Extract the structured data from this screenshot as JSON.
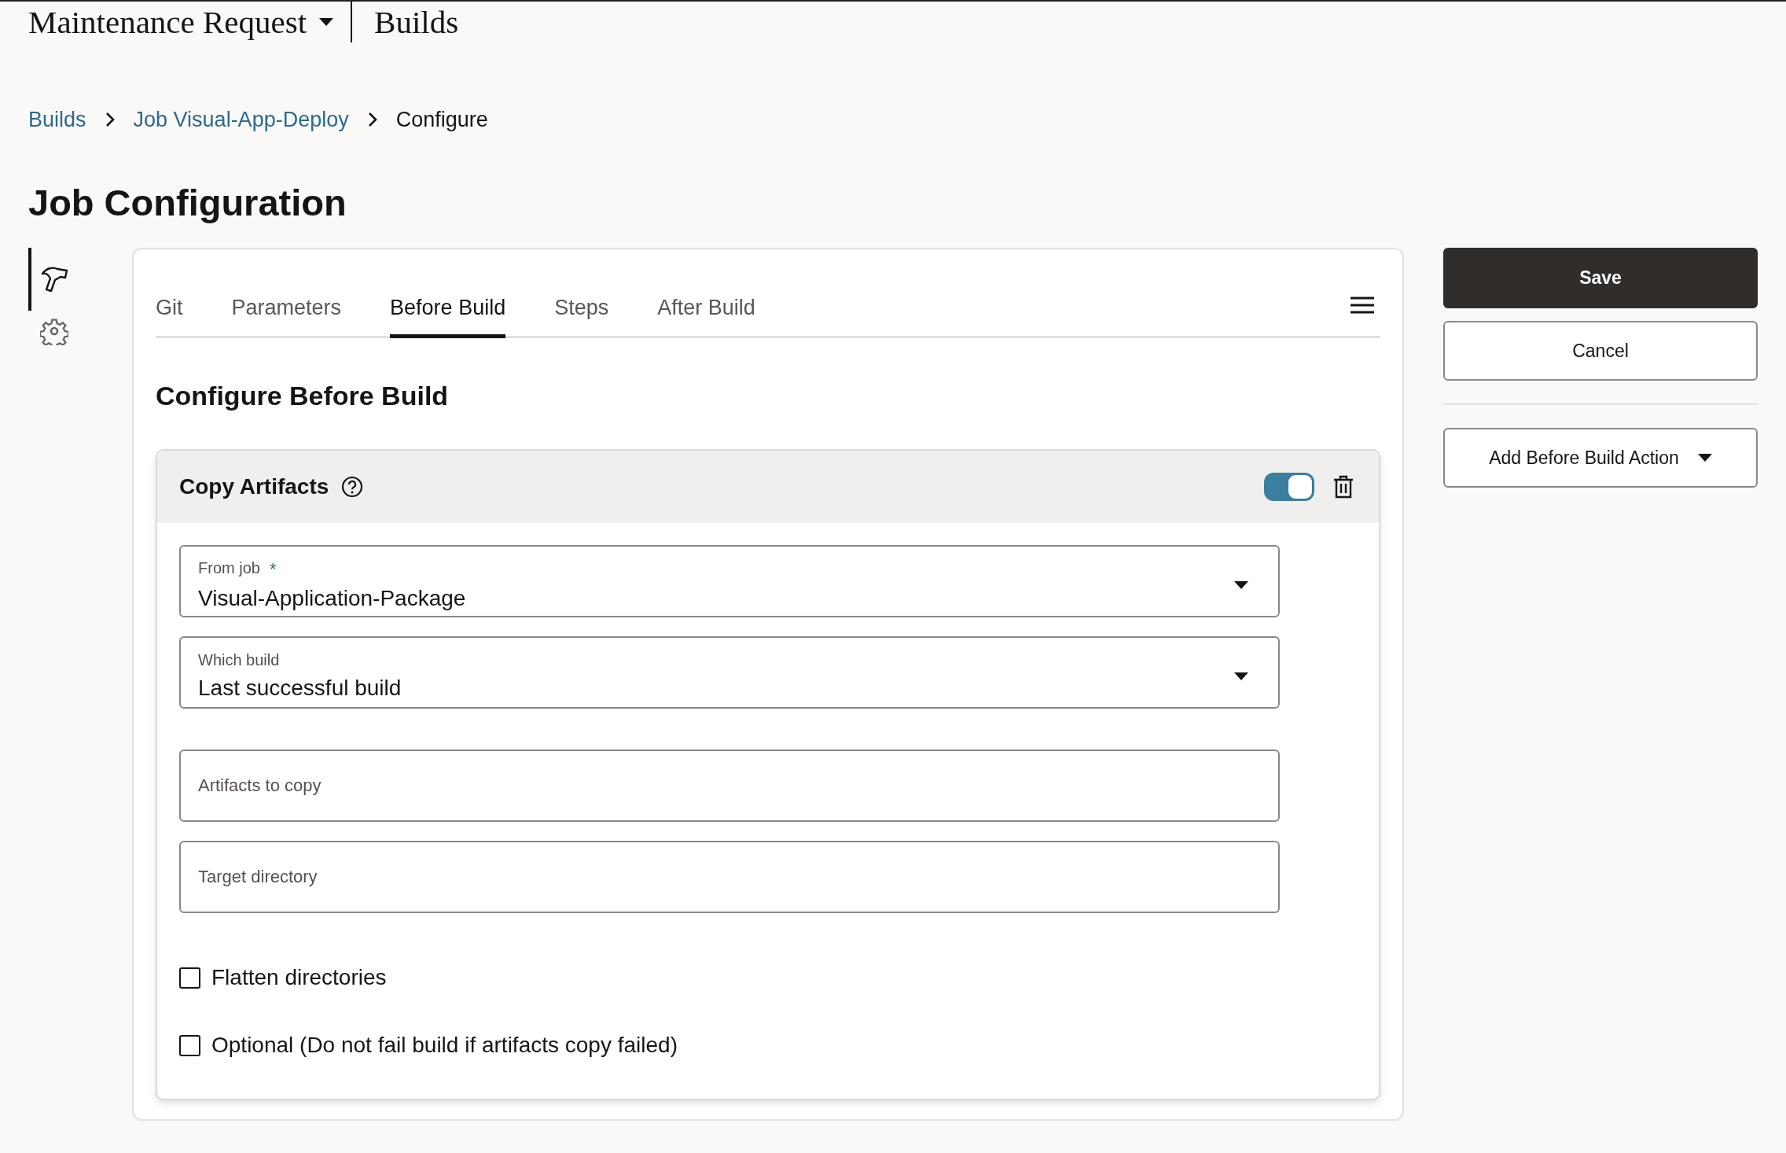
{
  "header": {
    "title": "Maintenance Request",
    "section": "Builds"
  },
  "breadcrumbs": [
    {
      "label": "Builds",
      "kind": "link"
    },
    {
      "label": "Job Visual-App-Deploy",
      "kind": "link"
    },
    {
      "label": "Configure",
      "kind": "current"
    }
  ],
  "page_title": "Job Configuration",
  "side_nav": [
    {
      "kind": "hammer",
      "selected": true
    },
    {
      "kind": "gear",
      "selected": false
    }
  ],
  "tabs": [
    {
      "label": "Git",
      "selected": false
    },
    {
      "label": "Parameters",
      "selected": false
    },
    {
      "label": "Before Build",
      "selected": true
    },
    {
      "label": "Steps",
      "selected": false
    },
    {
      "label": "After Build",
      "selected": false
    }
  ],
  "section_title": "Configure Before Build",
  "action": {
    "title": "Copy Artifacts",
    "enabled": true,
    "fields": [
      {
        "kind": "select",
        "label": "From job",
        "required_mark": "*",
        "value": "Visual-Application-Package"
      },
      {
        "kind": "select",
        "label": "Which build",
        "value": "Last successful build"
      },
      {
        "kind": "text",
        "placeholder": "Artifacts to copy"
      },
      {
        "kind": "text",
        "placeholder": "Target directory"
      }
    ],
    "options": [
      {
        "label": "Flatten directories",
        "checked": false
      },
      {
        "label": "Optional (Do not fail build if artifacts copy failed)",
        "checked": false
      }
    ]
  },
  "buttons": {
    "save": "Save",
    "cancel": "Cancel",
    "add_action": "Add Before Build Action"
  }
}
